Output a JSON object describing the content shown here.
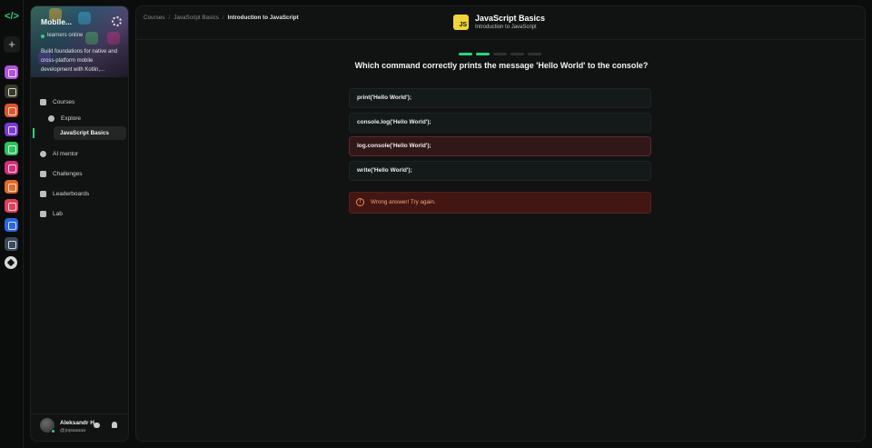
{
  "rail": {
    "logo_glyph": "</>",
    "add_glyph": "+",
    "apps": [
      {
        "name": "app-purple-icon",
        "color": "#b052e0"
      },
      {
        "name": "app-yellow-icon",
        "color": "#3a3a2a"
      },
      {
        "name": "app-orange-shield-icon",
        "color": "#e0542a"
      },
      {
        "name": "app-purple-infinity-icon",
        "color": "#7a3ad0"
      },
      {
        "name": "app-green-icon",
        "color": "#2ec060"
      },
      {
        "name": "app-magenta-icon",
        "color": "#d0307a"
      },
      {
        "name": "app-orange-icon",
        "color": "#e06a2a"
      },
      {
        "name": "app-pink-icon",
        "color": "#e0405a"
      },
      {
        "name": "app-blue-icon",
        "color": "#2a66e0"
      },
      {
        "name": "app-slate-icon",
        "color": "#3a4a5a"
      }
    ]
  },
  "sidebar": {
    "banner_title": "Mobile...",
    "online_text": "learners online",
    "description": "Build foundations for native and cross-platform mobile development with Kotlin,...",
    "items": [
      {
        "label": "Courses"
      },
      {
        "label": "Explore"
      },
      {
        "label": "JavaScript Basics"
      },
      {
        "label": "AI mentor"
      },
      {
        "label": "Challenges"
      },
      {
        "label": "Leaderboards"
      },
      {
        "label": "Lab"
      }
    ],
    "user": {
      "name": "Aleksandr H.",
      "handle": "@jopaaaaa"
    }
  },
  "breadcrumb": {
    "items": [
      "Courses",
      "JavaScript Basics",
      "Introduction to JavaScript"
    ],
    "separator": "/"
  },
  "course": {
    "badge": "JS",
    "title": "JavaScript Basics",
    "subtitle": "Introduction to JavaScript"
  },
  "progress": {
    "total_steps": 5,
    "completed_steps": 2
  },
  "quiz": {
    "question": "Which command correctly prints the message 'Hello World' to the console?",
    "options": [
      "print('Hello World');",
      "console.log('Hello World');",
      "log.console('Hello World');",
      "write('Hello World');"
    ],
    "selected_index": 2,
    "feedback": "Wrong answer! Try again.",
    "feedback_glyph": "!"
  },
  "colors": {
    "accent": "#2bd47d",
    "js_yellow": "#f0d43a",
    "error": "#f08a4a"
  }
}
